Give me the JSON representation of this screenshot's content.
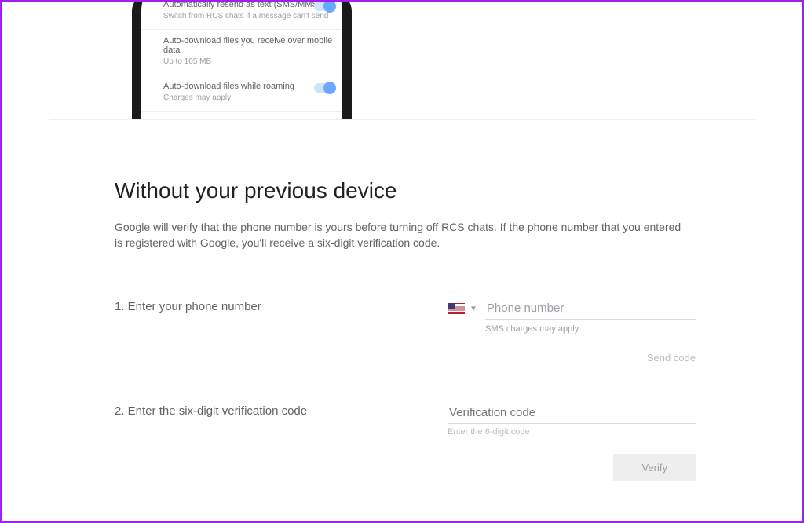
{
  "phone_settings": {
    "row1": {
      "title": "Automatically resend as text (SMS/MMS)",
      "sub": "Switch from RCS chats if a message can't send",
      "toggle": true
    },
    "row2": {
      "title": "Auto-download files you receive over mobile data",
      "sub": "Up to 105 MB",
      "toggle": false
    },
    "row3": {
      "title": "Auto-download files while roaming",
      "sub": "Charges may apply",
      "toggle": true
    }
  },
  "section": {
    "title": "Without your previous device",
    "lead": "Google will verify that the phone number is yours before turning off RCS chats. If the phone number that you entered is registered with Google, you'll receive a six-digit verification code."
  },
  "step1": {
    "label": "1. Enter your phone number",
    "country": "US",
    "placeholder": "Phone number",
    "hint": "SMS charges may apply",
    "send_label": "Send code"
  },
  "step2": {
    "label": "2. Enter the six-digit verification code",
    "placeholder": "Verification code",
    "hint": "Enter the 6-digit code",
    "verify_label": "Verify"
  }
}
